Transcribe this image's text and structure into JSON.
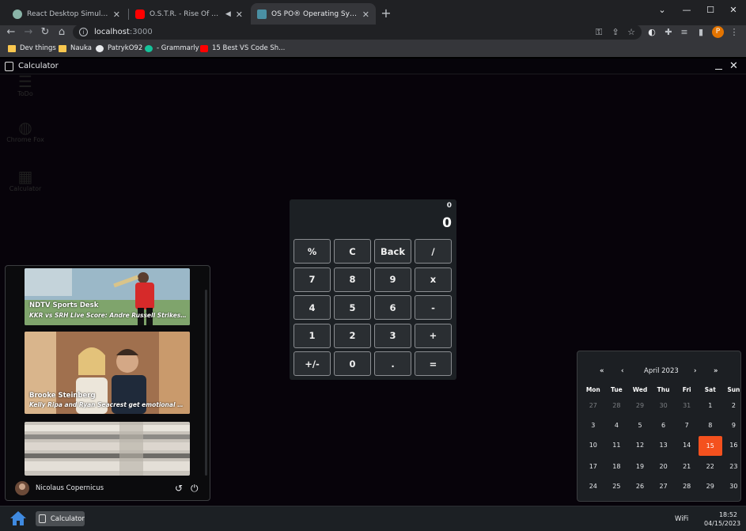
{
  "browser": {
    "tabs": [
      {
        "title": "React Desktop Simulation.",
        "icon": "react-favicon",
        "active": false
      },
      {
        "title": "O.S.T.R. - Rise Of The Sun - Y",
        "icon": "youtube-favicon",
        "active": false,
        "audio": true
      },
      {
        "title": "OS PO® Operating System-Patr",
        "icon": "app-favicon",
        "active": true
      }
    ],
    "new_tab": "+",
    "address": {
      "host": "localhost",
      "port": ":3000"
    },
    "profile_initial": "P",
    "bookmarks": [
      "Dev things",
      "Nauka",
      "PatrykO92",
      "- Grammarly",
      "15 Best VS Code Sh..."
    ]
  },
  "window": {
    "title": "Calculator",
    "minimize": "minimize",
    "close": "✕"
  },
  "desktop_icons": [
    {
      "label": "ToDo",
      "icon": "list-icon"
    },
    {
      "label": "Chrome Fox",
      "icon": "globe-icon"
    },
    {
      "label": "Calculator",
      "icon": "calculator-icon"
    }
  ],
  "calculator": {
    "previous": "0",
    "current": "0",
    "keys": [
      "%",
      "C",
      "Back",
      "/",
      "7",
      "8",
      "9",
      "x",
      "4",
      "5",
      "6",
      "-",
      "1",
      "2",
      "3",
      "+",
      "+/-",
      "0",
      ".",
      "="
    ]
  },
  "news": [
    {
      "source": "NDTV Sports Desk",
      "headline": "KKR vs SRH Live Score: Andre Russell Strikes Tw..."
    },
    {
      "source": "Brooke Steinberg",
      "headline": "Kelly Ripa and Ryan Seacrest get emotional on ..."
    },
    {
      "source": "",
      "headline": ""
    }
  ],
  "user": {
    "name": "Nicolaus Copernicus"
  },
  "calendar": {
    "nav_prev_year": "«",
    "nav_prev_month": "‹",
    "month_label": "April 2023",
    "nav_next_month": "›",
    "nav_next_year": "»",
    "weekdays": [
      "Mon",
      "Tue",
      "Wed",
      "Thu",
      "Fri",
      "Sat",
      "Sun"
    ],
    "days": [
      {
        "d": "27",
        "other": true
      },
      {
        "d": "28",
        "other": true
      },
      {
        "d": "29",
        "other": true
      },
      {
        "d": "30",
        "other": true
      },
      {
        "d": "31",
        "other": true
      },
      {
        "d": "1"
      },
      {
        "d": "2"
      },
      {
        "d": "3"
      },
      {
        "d": "4"
      },
      {
        "d": "5"
      },
      {
        "d": "6"
      },
      {
        "d": "7"
      },
      {
        "d": "8"
      },
      {
        "d": "9"
      },
      {
        "d": "10"
      },
      {
        "d": "11"
      },
      {
        "d": "12"
      },
      {
        "d": "13"
      },
      {
        "d": "14"
      },
      {
        "d": "15",
        "today": true
      },
      {
        "d": "16"
      },
      {
        "d": "17"
      },
      {
        "d": "18"
      },
      {
        "d": "19"
      },
      {
        "d": "20"
      },
      {
        "d": "21"
      },
      {
        "d": "22"
      },
      {
        "d": "23"
      },
      {
        "d": "24"
      },
      {
        "d": "25"
      },
      {
        "d": "26"
      },
      {
        "d": "27"
      },
      {
        "d": "28"
      },
      {
        "d": "29"
      },
      {
        "d": "30"
      }
    ],
    "today_color": "#f4511e"
  },
  "taskbar": {
    "task_label": "Calculator",
    "wifi": "WiFi",
    "time": "18:52",
    "date": "04/15/2023"
  }
}
